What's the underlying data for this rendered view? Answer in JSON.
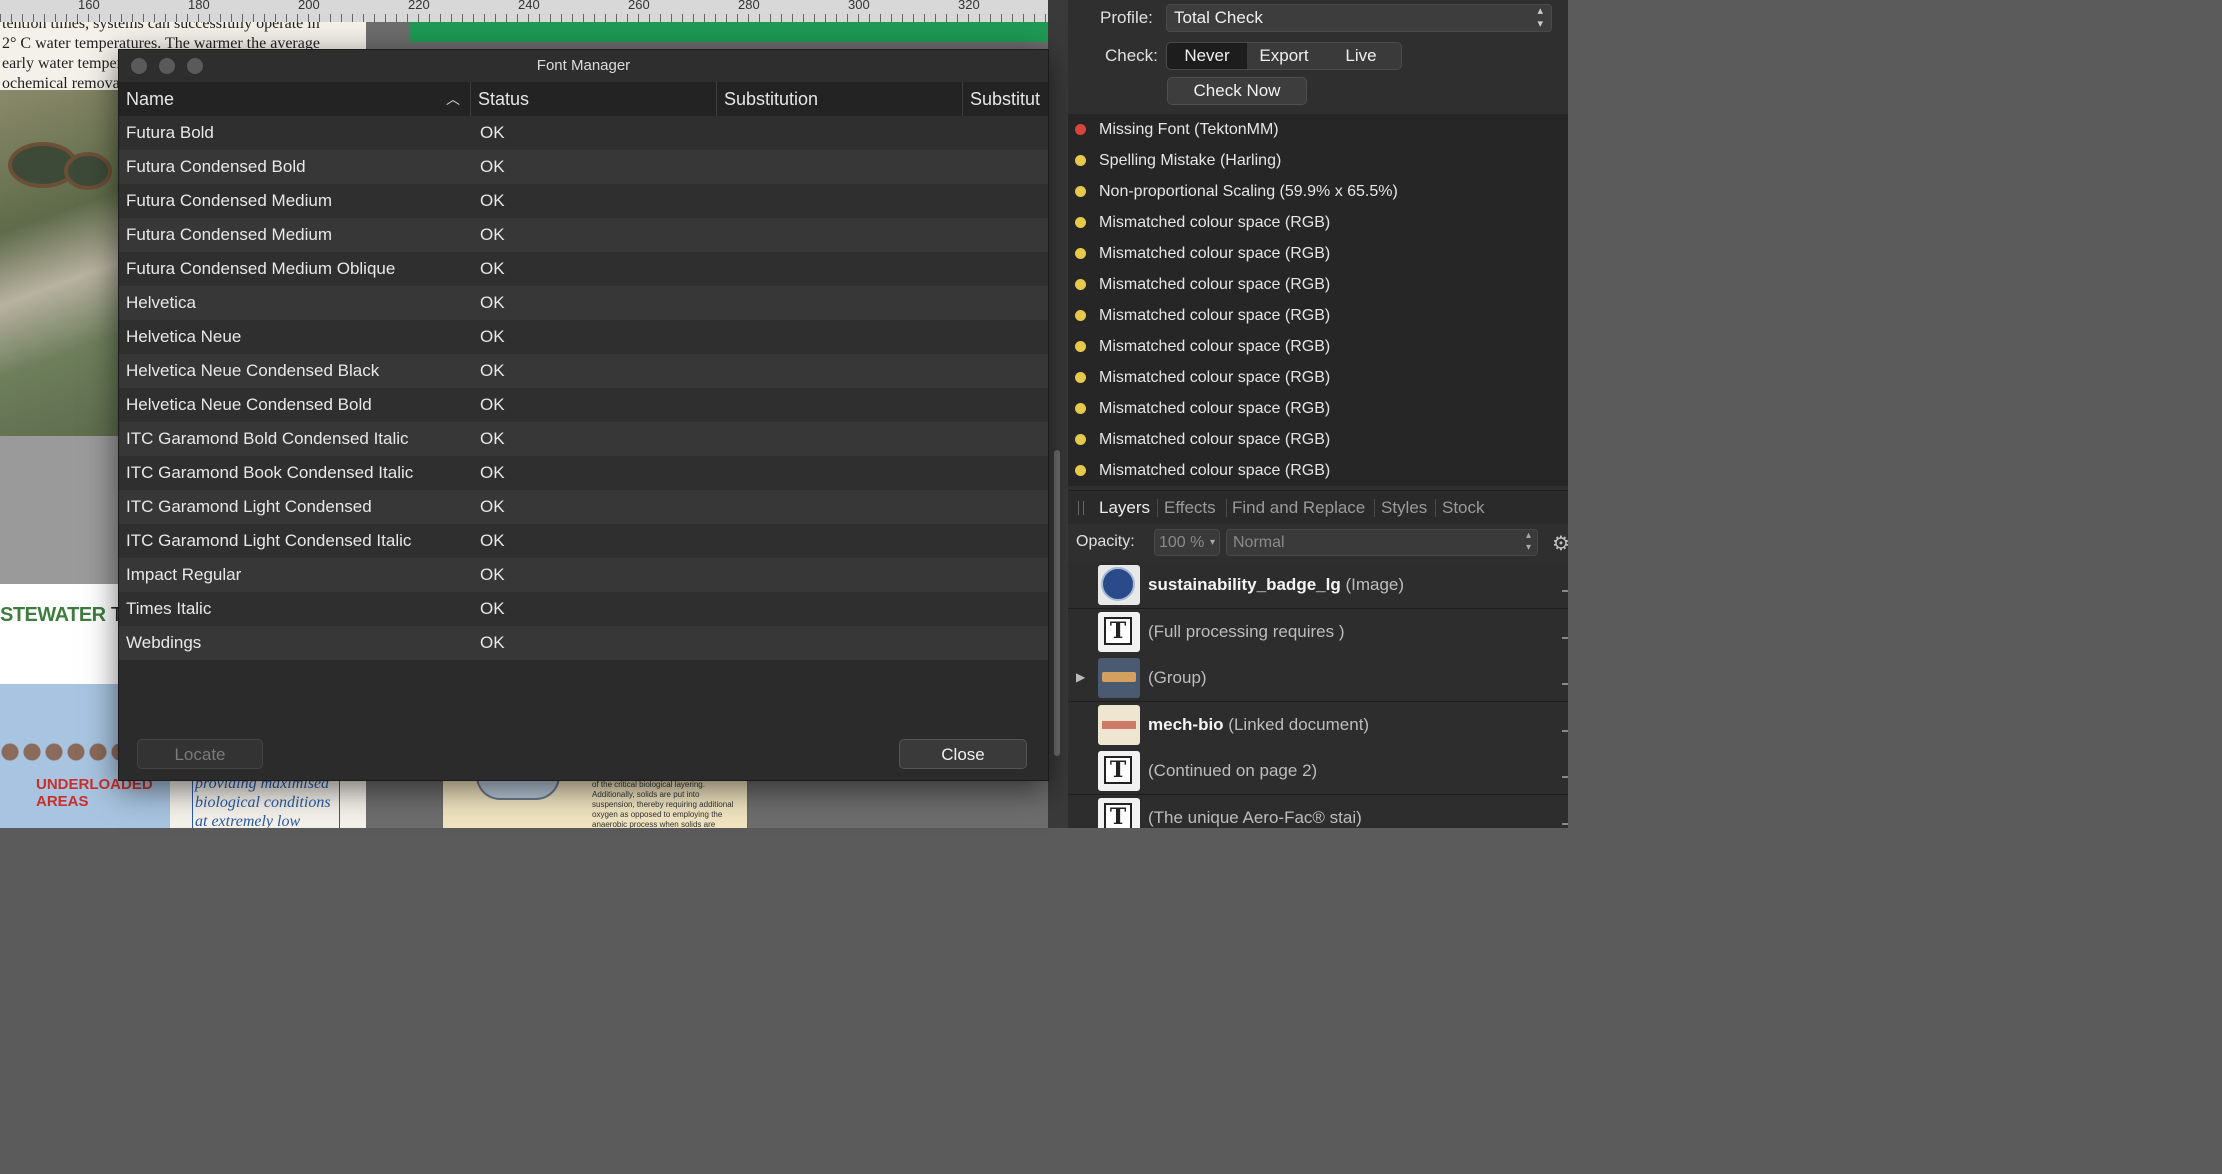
{
  "ruler": {
    "labels": [
      "160",
      "180",
      "200",
      "220",
      "240",
      "260",
      "280",
      "300",
      "320"
    ]
  },
  "document": {
    "top_text": "tention times, systems can successfully operate in 2° C water temperatures. The warmer the average early water temperature, the faster the biological/ ochemical removal",
    "headline_bold": "STEWATER",
    "headline_rest": "TRE",
    "underloaded": "UNDERLOADED AREAS",
    "blue_italic": "providing maximised biological conditions at extremely low energy",
    "beige_text": "of the critical biological layering. Additionally, solids are put into suspension, thereby requiring additional oxygen as opposed to employing the anaerobic process when solids are allowed to settle."
  },
  "dialog": {
    "title": "Font Manager",
    "columns": [
      "Name",
      "Status",
      "Substitution",
      "Substitut"
    ],
    "rows": [
      {
        "name": "Futura Bold",
        "status": "OK"
      },
      {
        "name": "Futura Condensed Bold",
        "status": "OK"
      },
      {
        "name": "Futura Condensed Medium",
        "status": "OK"
      },
      {
        "name": "Futura Condensed Medium",
        "status": "OK"
      },
      {
        "name": "Futura Condensed Medium Oblique",
        "status": "OK"
      },
      {
        "name": "Helvetica",
        "status": "OK"
      },
      {
        "name": "Helvetica Neue",
        "status": "OK"
      },
      {
        "name": "Helvetica Neue Condensed Black",
        "status": "OK"
      },
      {
        "name": "Helvetica Neue Condensed Bold",
        "status": "OK"
      },
      {
        "name": "ITC Garamond Bold Condensed Italic",
        "status": "OK"
      },
      {
        "name": "ITC Garamond Book Condensed Italic",
        "status": "OK"
      },
      {
        "name": "ITC Garamond Light Condensed",
        "status": "OK"
      },
      {
        "name": "ITC Garamond Light Condensed Italic",
        "status": "OK"
      },
      {
        "name": "Impact Regular",
        "status": "OK"
      },
      {
        "name": "Times Italic",
        "status": "OK"
      },
      {
        "name": "Webdings",
        "status": "OK"
      }
    ],
    "locate_label": "Locate",
    "close_label": "Close"
  },
  "preflight": {
    "profile_label": "Profile:",
    "profile_value": "Total Check",
    "check_label": "Check:",
    "check_options": [
      "Never",
      "Export",
      "Live"
    ],
    "check_now_label": "Check Now",
    "issues": [
      {
        "text": "Missing Font (TektonMM)",
        "color": "#d9453a"
      },
      {
        "text": "Spelling Mistake (Harling)",
        "color": "#e6c84a"
      },
      {
        "text": "Non-proportional Scaling (59.9% x 65.5%)",
        "color": "#e6c84a"
      },
      {
        "text": "Mismatched colour space (RGB)",
        "color": "#e6c84a"
      },
      {
        "text": "Mismatched colour space (RGB)",
        "color": "#e6c84a"
      },
      {
        "text": "Mismatched colour space (RGB)",
        "color": "#e6c84a"
      },
      {
        "text": "Mismatched colour space (RGB)",
        "color": "#e6c84a"
      },
      {
        "text": "Mismatched colour space (RGB)",
        "color": "#e6c84a"
      },
      {
        "text": "Mismatched colour space (RGB)",
        "color": "#e6c84a"
      },
      {
        "text": "Mismatched colour space (RGB)",
        "color": "#e6c84a"
      },
      {
        "text": "Mismatched colour space (RGB)",
        "color": "#e6c84a"
      },
      {
        "text": "Mismatched colour space (RGB)",
        "color": "#e6c84a"
      }
    ]
  },
  "panel_tabs": [
    "Layers",
    "Effects",
    "Find and Replace",
    "Styles",
    "Stock"
  ],
  "layers_panel": {
    "opacity_label": "Opacity:",
    "opacity_value": "100 %",
    "blend_mode": "Normal",
    "items": [
      {
        "name": "sustainability_badge_lg",
        "kind": "(Image)",
        "thumb": "badge-thumbnail"
      },
      {
        "name": "",
        "kind": "(Full processing requires )",
        "thumb": "text-frame-icon"
      },
      {
        "name": "",
        "kind": "(Group)",
        "thumb": "group-thumbnail"
      },
      {
        "name": "mech-bio",
        "kind": "(Linked document)",
        "thumb": "linked-document-thumbnail"
      },
      {
        "name": "",
        "kind": "(Continued on page 2)",
        "thumb": "text-frame-icon"
      },
      {
        "name": "",
        "kind": "(The unique Aero-Fac® stai)",
        "thumb": "text-frame-icon"
      }
    ]
  }
}
